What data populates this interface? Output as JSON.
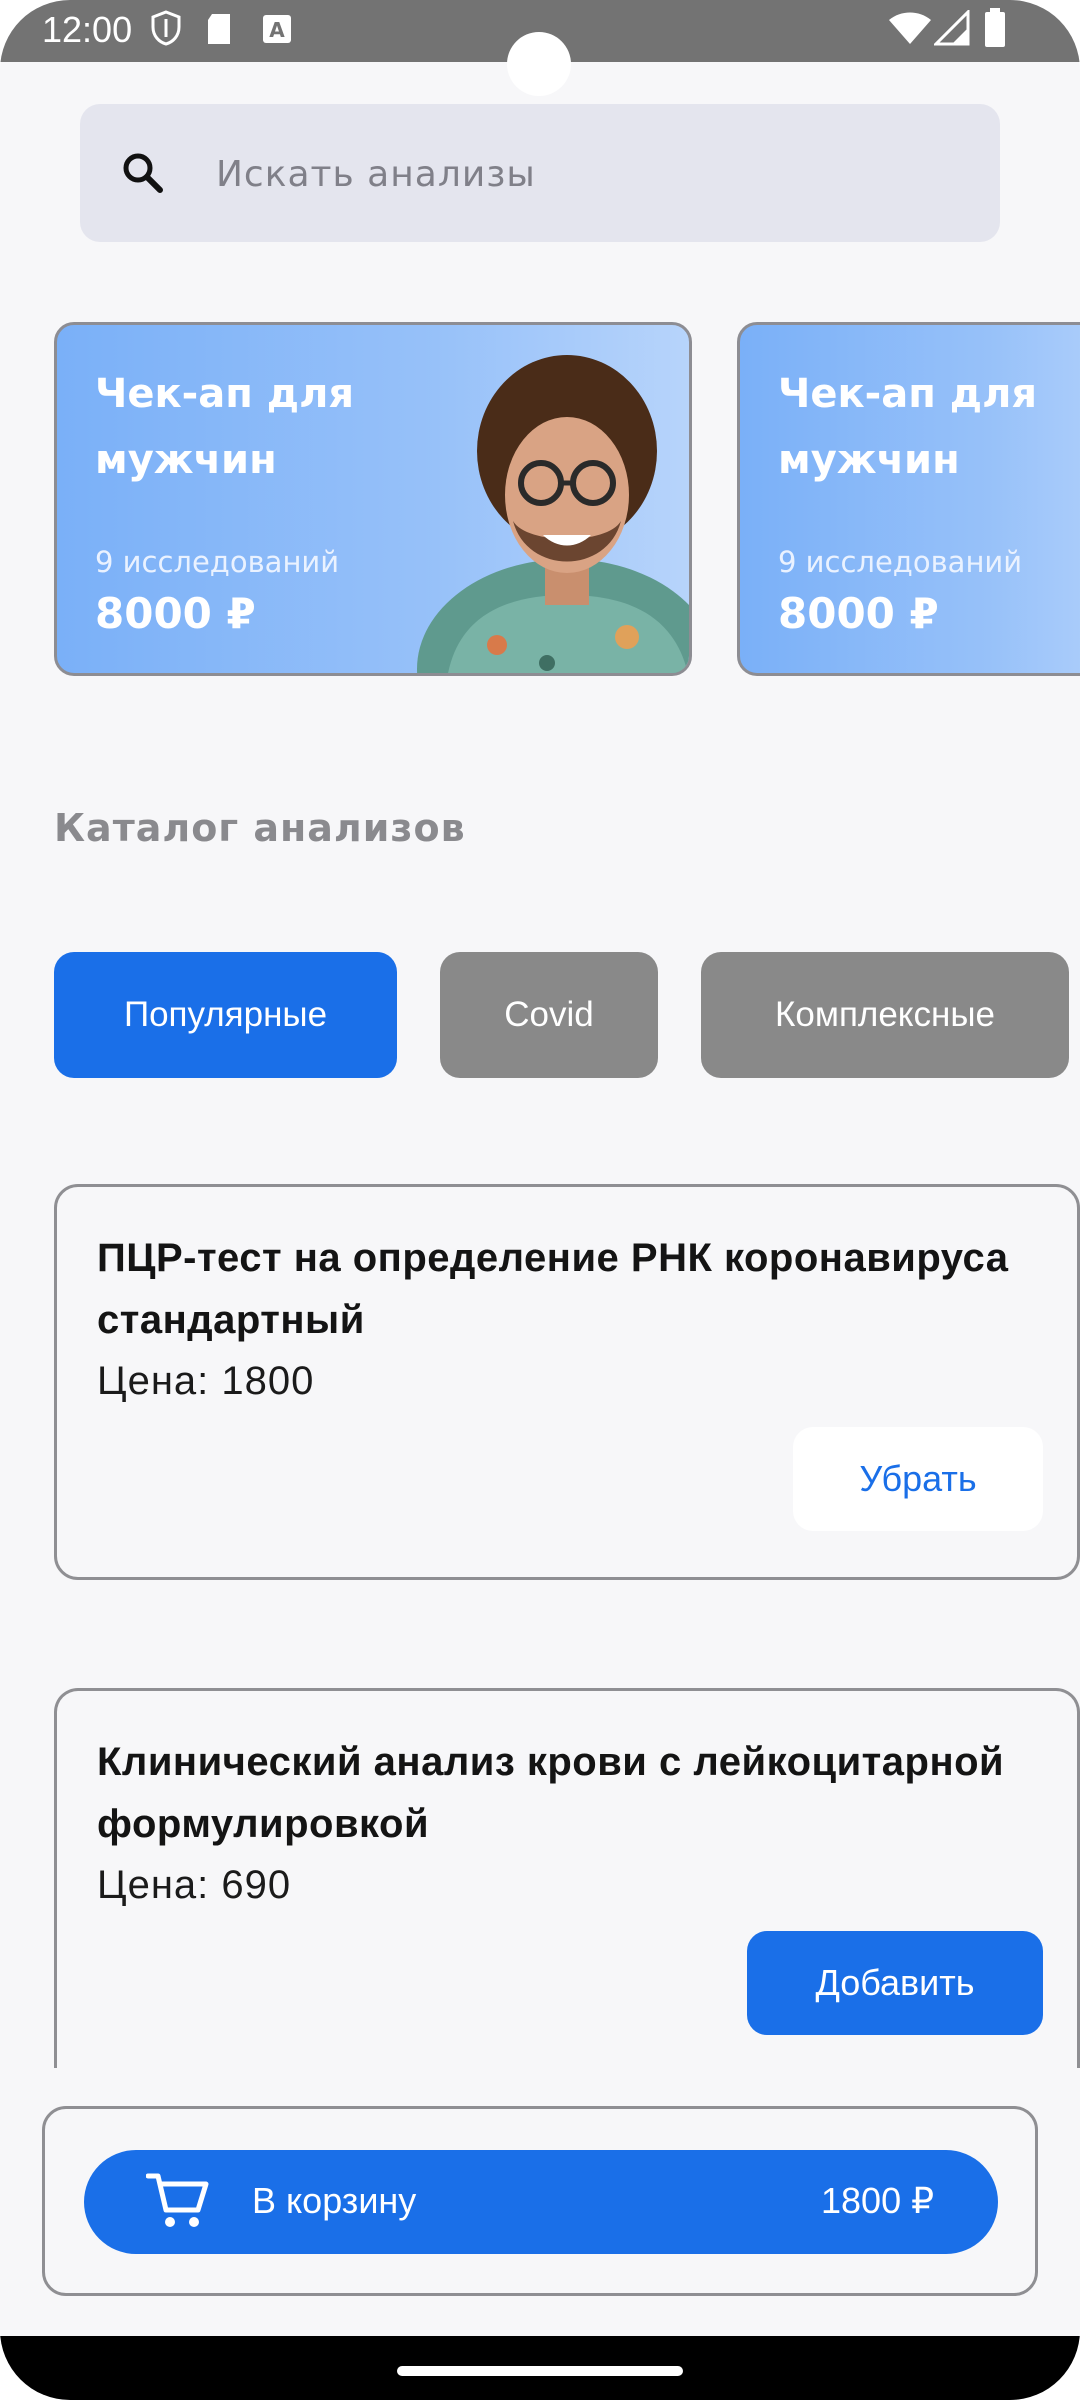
{
  "status_bar": {
    "time": "12:00",
    "icons": [
      "shield-icon",
      "sd-card-icon",
      "keyboard-a-icon",
      "wifi-icon",
      "signal-icon",
      "battery-icon"
    ]
  },
  "search": {
    "placeholder": "Искать анализы",
    "icon": "search-icon"
  },
  "promos": [
    {
      "title": "Чек-ап для мужчин",
      "count": "9 исследований",
      "price": "8000 ₽"
    },
    {
      "title": "Чек-ап для мужчин",
      "count": "9 исследований",
      "price": "8000 ₽"
    }
  ],
  "catalog": {
    "title": "Каталог анализов",
    "categories": [
      {
        "label": "Популярные",
        "active": true
      },
      {
        "label": "Covid",
        "active": false
      },
      {
        "label": "Комплексные",
        "active": false
      }
    ]
  },
  "analyses": [
    {
      "name": "ПЦР-тест на определение РНК коронавируса стандартный",
      "price": "Цена: 1800",
      "button": "Убрать"
    },
    {
      "name": "Клинический анализ крови с лейкоцитарной формулировкой",
      "price": "Цена: 690",
      "button": "Добавить"
    }
  ],
  "cart": {
    "label": "В корзину",
    "total": "1800 ₽",
    "icon": "cart-icon"
  },
  "colors": {
    "accent": "#1a6fe8",
    "chip_inactive": "#898989",
    "status_bar": "#737373",
    "background": "#f7f7f9"
  }
}
